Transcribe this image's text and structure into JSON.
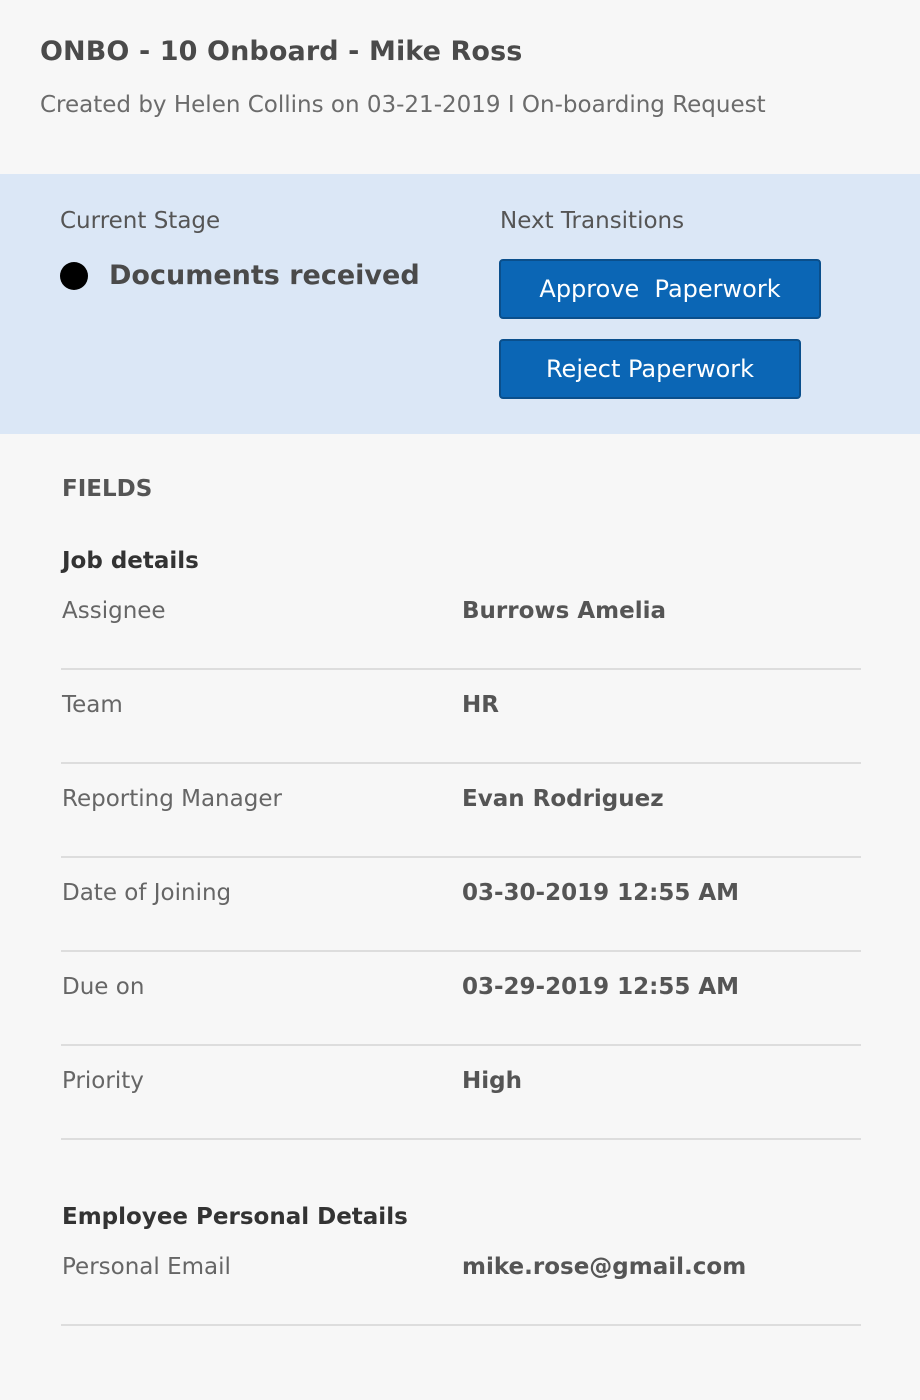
{
  "header": {
    "title": "ONBO - 10 Onboard - Mike Ross",
    "subtitle": "Created by Helen Collins on 03-21-2019 I On-boarding Request"
  },
  "stage": {
    "current_label": "Current Stage",
    "current_value": "Documents received",
    "next_label": "Next Transitions",
    "transitions": [
      {
        "label": "Approve  Paperwork"
      },
      {
        "label": "Reject Paperwork"
      }
    ]
  },
  "fields": {
    "heading": "FIELDS",
    "sections": [
      {
        "title": "Job details",
        "rows": [
          {
            "label": "Assignee",
            "value": "Burrows Amelia"
          },
          {
            "label": "Team",
            "value": "HR"
          },
          {
            "label": "Reporting Manager",
            "value": "Evan Rodriguez"
          },
          {
            "label": "Date of Joining",
            "value": "03-30-2019 12:55 AM"
          },
          {
            "label": "Due on",
            "value": "03-29-2019 12:55 AM"
          },
          {
            "label": "Priority",
            "value": "High"
          }
        ]
      },
      {
        "title": "Employee Personal Details",
        "rows": [
          {
            "label": "Personal Email",
            "value": "mike.rose@gmail.com"
          }
        ]
      }
    ]
  },
  "colors": {
    "page_background": "#f7f7f7",
    "stage_panel_background": "#dbe7f6",
    "button_background": "#0b66b5",
    "stage_dot": "#000000"
  },
  "icons": {
    "stage_indicator": "filled-circle-icon"
  }
}
